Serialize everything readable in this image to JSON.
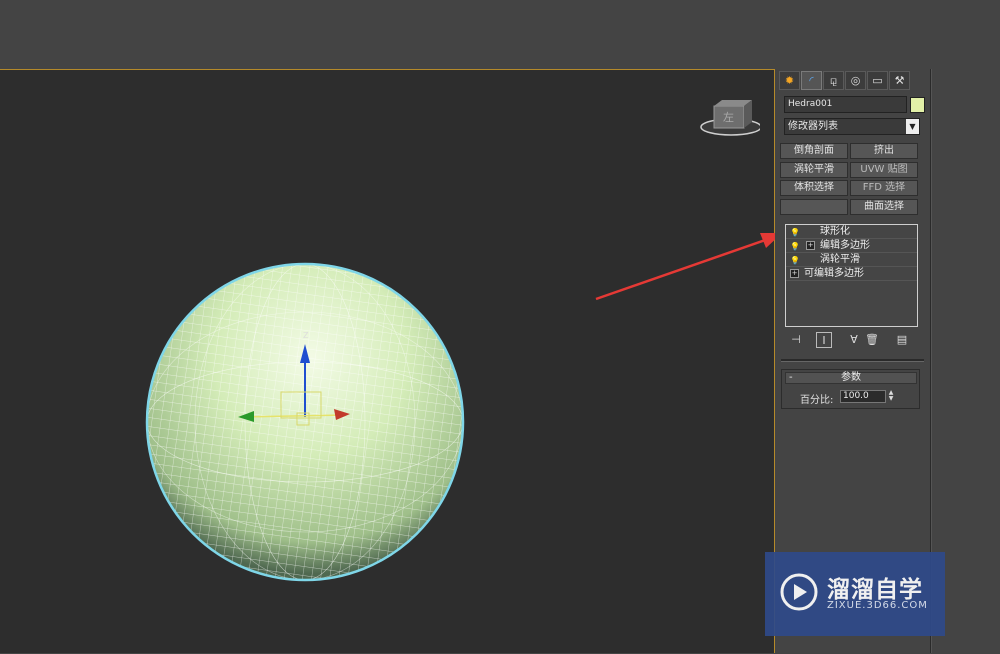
{
  "viewport": {
    "gizmo_axis_label": "Z",
    "viewcube_face_label": "左"
  },
  "command_panel": {
    "tabs": [
      {
        "name": "create-tab",
        "icon": "sun-icon",
        "glyph": "✹"
      },
      {
        "name": "modify-tab",
        "icon": "curve-icon",
        "glyph": "◜"
      },
      {
        "name": "hierarchy-tab",
        "icon": "hierarchy-icon",
        "glyph": "⚼"
      },
      {
        "name": "motion-tab",
        "icon": "motion-icon",
        "glyph": "◎"
      },
      {
        "name": "display-tab",
        "icon": "monitor-icon",
        "glyph": "▭"
      },
      {
        "name": "utilities-tab",
        "icon": "hammer-icon",
        "glyph": "⚒"
      }
    ],
    "object_name": "Hedra001",
    "object_color": "#e3f1a8",
    "modifier_list_label": "修改器列表",
    "modifier_buttons": [
      "倒角剖面",
      "挤出",
      "涡轮平滑",
      "UVW 贴图",
      "体积选择",
      "FFD 选择",
      "",
      "曲面选择"
    ],
    "modifier_stack": [
      {
        "label": "球形化",
        "has_bulb": true,
        "has_plus": false
      },
      {
        "label": "编辑多边形",
        "has_bulb": true,
        "has_plus": true
      },
      {
        "label": "涡轮平滑",
        "has_bulb": true,
        "has_plus": false
      },
      {
        "label": "可编辑多边形",
        "has_bulb": false,
        "has_plus": true
      }
    ],
    "stack_tools": [
      "pin-stack-icon",
      "show-end-result-icon",
      "make-unique-icon",
      "remove-modifier-icon",
      "configure-sets-icon"
    ],
    "parameters": {
      "rollout_title": "参数",
      "collapse_symbol": "-",
      "percent_label": "百分比:",
      "percent_value": "100.0"
    }
  },
  "watermark": {
    "title": "溜溜自学",
    "url": "ZIXUE.3D66.COM"
  },
  "colors": {
    "viewport_bg": "#2d2d2d",
    "ui_bg": "#444444",
    "viewport_border": "#b58a2a",
    "annotation_arrow": "#e53935",
    "sphere_fill": "#d8efc0",
    "watermark_bg": "#2f4a8a"
  }
}
